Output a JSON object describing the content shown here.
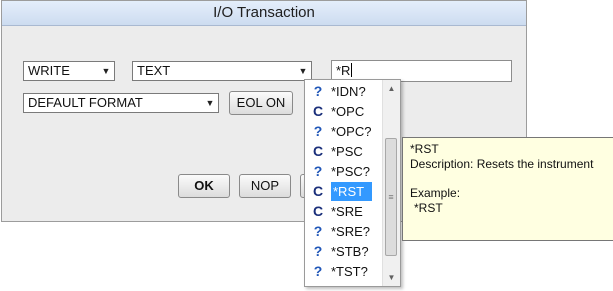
{
  "window": {
    "title": "I/O Transaction"
  },
  "form": {
    "direction_select": "WRITE",
    "type_select": "TEXT",
    "command_input_value": "*R",
    "format_select": "DEFAULT FORMAT",
    "eol_button_label": "EOL ON"
  },
  "buttons": {
    "ok_label": "OK",
    "nop_label": "NOP"
  },
  "autocomplete": {
    "items": [
      {
        "label": "*IDN?",
        "icon": "query-icon",
        "glyph": "?"
      },
      {
        "label": "*OPC",
        "icon": "command-icon",
        "glyph": "C"
      },
      {
        "label": "*OPC?",
        "icon": "query-icon",
        "glyph": "?"
      },
      {
        "label": "*PSC",
        "icon": "command-icon",
        "glyph": "C"
      },
      {
        "label": "*PSC?",
        "icon": "query-icon",
        "glyph": "?"
      },
      {
        "label": "*RST",
        "icon": "command-icon",
        "glyph": "C",
        "selected": true
      },
      {
        "label": "*SRE",
        "icon": "command-icon",
        "glyph": "C"
      },
      {
        "label": "*SRE?",
        "icon": "query-icon",
        "glyph": "?"
      },
      {
        "label": "*STB?",
        "icon": "query-icon",
        "glyph": "?"
      },
      {
        "label": "*TST?",
        "icon": "query-icon",
        "glyph": "?"
      }
    ],
    "scroll_up_glyph": "▲",
    "scroll_down_glyph": "▼",
    "thumb_grip_glyph": "≡"
  },
  "tooltip": {
    "name": "*RST",
    "description": "Description: Resets the instrument",
    "example_label": "Example:",
    "example_value": "*RST"
  },
  "colors": {
    "selection": "#3399ff",
    "tooltip_bg": "#ffffe1",
    "titlebar": "#cddcf0"
  }
}
